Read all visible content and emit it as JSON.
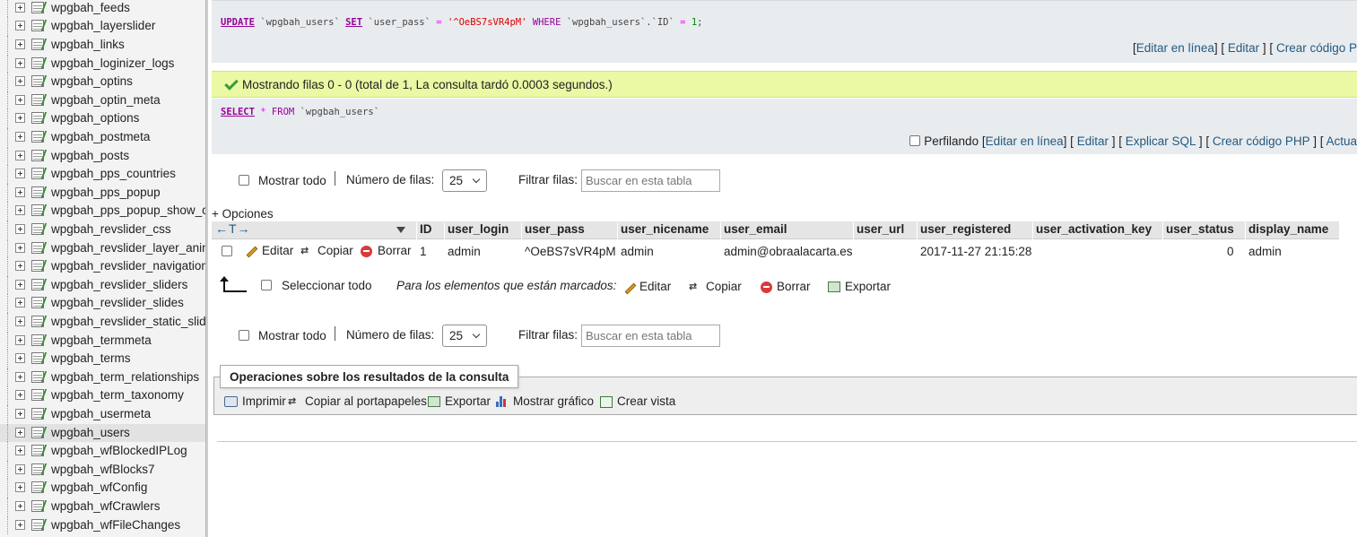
{
  "sidebar": {
    "items": [
      {
        "label": "wpgbah_feeds"
      },
      {
        "label": "wpgbah_layerslider"
      },
      {
        "label": "wpgbah_links"
      },
      {
        "label": "wpgbah_loginizer_logs"
      },
      {
        "label": "wpgbah_optins"
      },
      {
        "label": "wpgbah_optin_meta"
      },
      {
        "label": "wpgbah_options"
      },
      {
        "label": "wpgbah_postmeta"
      },
      {
        "label": "wpgbah_posts"
      },
      {
        "label": "wpgbah_pps_countries"
      },
      {
        "label": "wpgbah_pps_popup"
      },
      {
        "label": "wpgbah_pps_popup_show_ca"
      },
      {
        "label": "wpgbah_revslider_css"
      },
      {
        "label": "wpgbah_revslider_layer_anim"
      },
      {
        "label": "wpgbah_revslider_navigations"
      },
      {
        "label": "wpgbah_revslider_sliders"
      },
      {
        "label": "wpgbah_revslider_slides"
      },
      {
        "label": "wpgbah_revslider_static_slide"
      },
      {
        "label": "wpgbah_termmeta"
      },
      {
        "label": "wpgbah_terms"
      },
      {
        "label": "wpgbah_term_relationships"
      },
      {
        "label": "wpgbah_term_taxonomy"
      },
      {
        "label": "wpgbah_usermeta"
      },
      {
        "label": "wpgbah_users",
        "active": true
      },
      {
        "label": "wpgbah_wfBlockedIPLog"
      },
      {
        "label": "wpgbah_wfBlocks7"
      },
      {
        "label": "wpgbah_wfConfig"
      },
      {
        "label": "wpgbah_wfCrawlers"
      },
      {
        "label": "wpgbah_wfFileChanges"
      }
    ]
  },
  "update_query": {
    "kw_update": "UPDATE",
    "table": "`wpgbah_users`",
    "kw_set": "SET",
    "column": "`user_pass`",
    "eq": "=",
    "value": "'^OeBS7sVR4pM'",
    "kw_where": "WHERE",
    "where_col": "`wpgbah_users`.`ID`",
    "eq2": "=",
    "num": "1",
    "semi": ";",
    "links": {
      "open": "[",
      "edit_inline": "Editar en línea",
      "sep1": "] [",
      "edit": "Editar",
      "sep2": "] [",
      "create_code": "Crear código P"
    }
  },
  "success_message": "Mostrando filas 0 - 0 (total de 1, La consulta tardó 0.0003 segundos.)",
  "select_query": {
    "kw_select": "SELECT",
    "star": "*",
    "kw_from": "FROM",
    "table": "`wpgbah_users`",
    "profiling_label": "Perfilando",
    "links": {
      "open": "[",
      "edit_inline": "Editar en línea",
      "sep1": "] [",
      "edit": "Editar",
      "sep2": "] [",
      "explain": "Explicar SQL",
      "sep3": "] [",
      "create_php": "Crear código PHP",
      "sep4": "] [",
      "refresh": "Actua"
    }
  },
  "nav": {
    "show_all": "Mostrar todo",
    "rows_label": "Número de filas:",
    "rows_value": "25",
    "filter_label": "Filtrar filas:",
    "filter_placeholder": "Buscar en esta tabla"
  },
  "options_link": "+ Opciones",
  "column_nav_arrows": "←T→",
  "columns": [
    "ID",
    "user_login",
    "user_pass",
    "user_nicename",
    "user_email",
    "user_url",
    "user_registered",
    "user_activation_key",
    "user_status",
    "display_name"
  ],
  "row": {
    "edit": "Editar",
    "copy": "Copiar",
    "delete": "Borrar",
    "cells": [
      "1",
      "admin",
      "^OeBS7sVR4pM",
      "admin",
      "admin@obraalacarta.es",
      "",
      "2017-11-27 21:15:28",
      "",
      "0",
      "admin"
    ]
  },
  "bulk": {
    "select_all": "Seleccionar todo",
    "with_selected": "Para los elementos que están marcados:",
    "edit": "Editar",
    "copy": "Copiar",
    "delete": "Borrar",
    "export": "Exportar"
  },
  "operations": {
    "legend": "Operaciones sobre los resultados de la consulta",
    "print": "Imprimir",
    "copy_clipboard": "Copiar al portapapeles",
    "export": "Exportar",
    "chart": "Mostrar gráfico",
    "create_view": "Crear vista"
  },
  "colors": {
    "link": "#235a81",
    "success_bg": "#ebf8a4",
    "sql_bg": "#e8ecef",
    "keyword": "#990099"
  }
}
